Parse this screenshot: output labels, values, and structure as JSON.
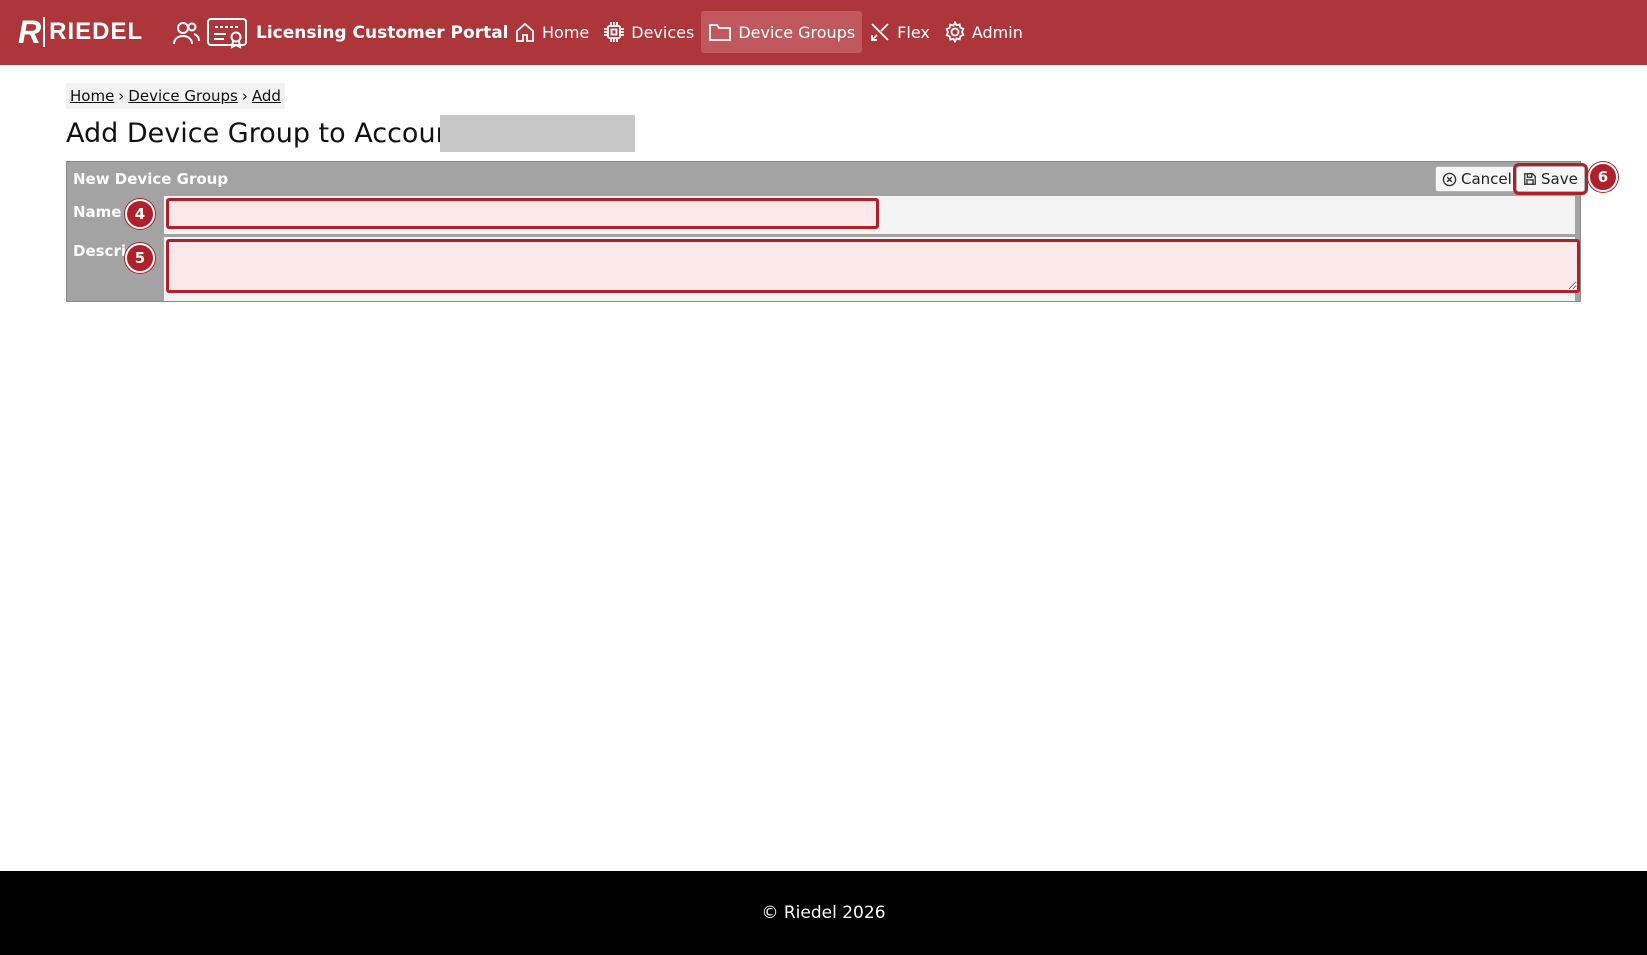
{
  "brand": {
    "logo_mark": "R",
    "logo_text": "RIEDEL"
  },
  "portal": {
    "title": "Licensing Customer Portal"
  },
  "nav": {
    "items": [
      {
        "label": "Home",
        "icon": "home-icon"
      },
      {
        "label": "Devices",
        "icon": "chip-icon"
      },
      {
        "label": "Device Groups",
        "icon": "folder-icon",
        "active": true
      },
      {
        "label": "Flex",
        "icon": "flex-icon"
      },
      {
        "label": "Admin",
        "icon": "gear-icon"
      }
    ]
  },
  "breadcrumb": {
    "items": [
      "Home",
      "Device Groups",
      "Add"
    ]
  },
  "page": {
    "title": "Add Device Group to Account"
  },
  "form": {
    "section_title": "New Device Group",
    "cancel_label": "Cancel",
    "save_label": "Save",
    "name_label": "Name",
    "name_value": "",
    "description_label": "Descrip",
    "description_value": ""
  },
  "annotations": [
    "4",
    "5",
    "6"
  ],
  "footer": {
    "text": "© Riedel 2026"
  },
  "colors": {
    "brand_red": "#ad363a",
    "highlight_red": "#b0202a",
    "footer": "#000000"
  }
}
